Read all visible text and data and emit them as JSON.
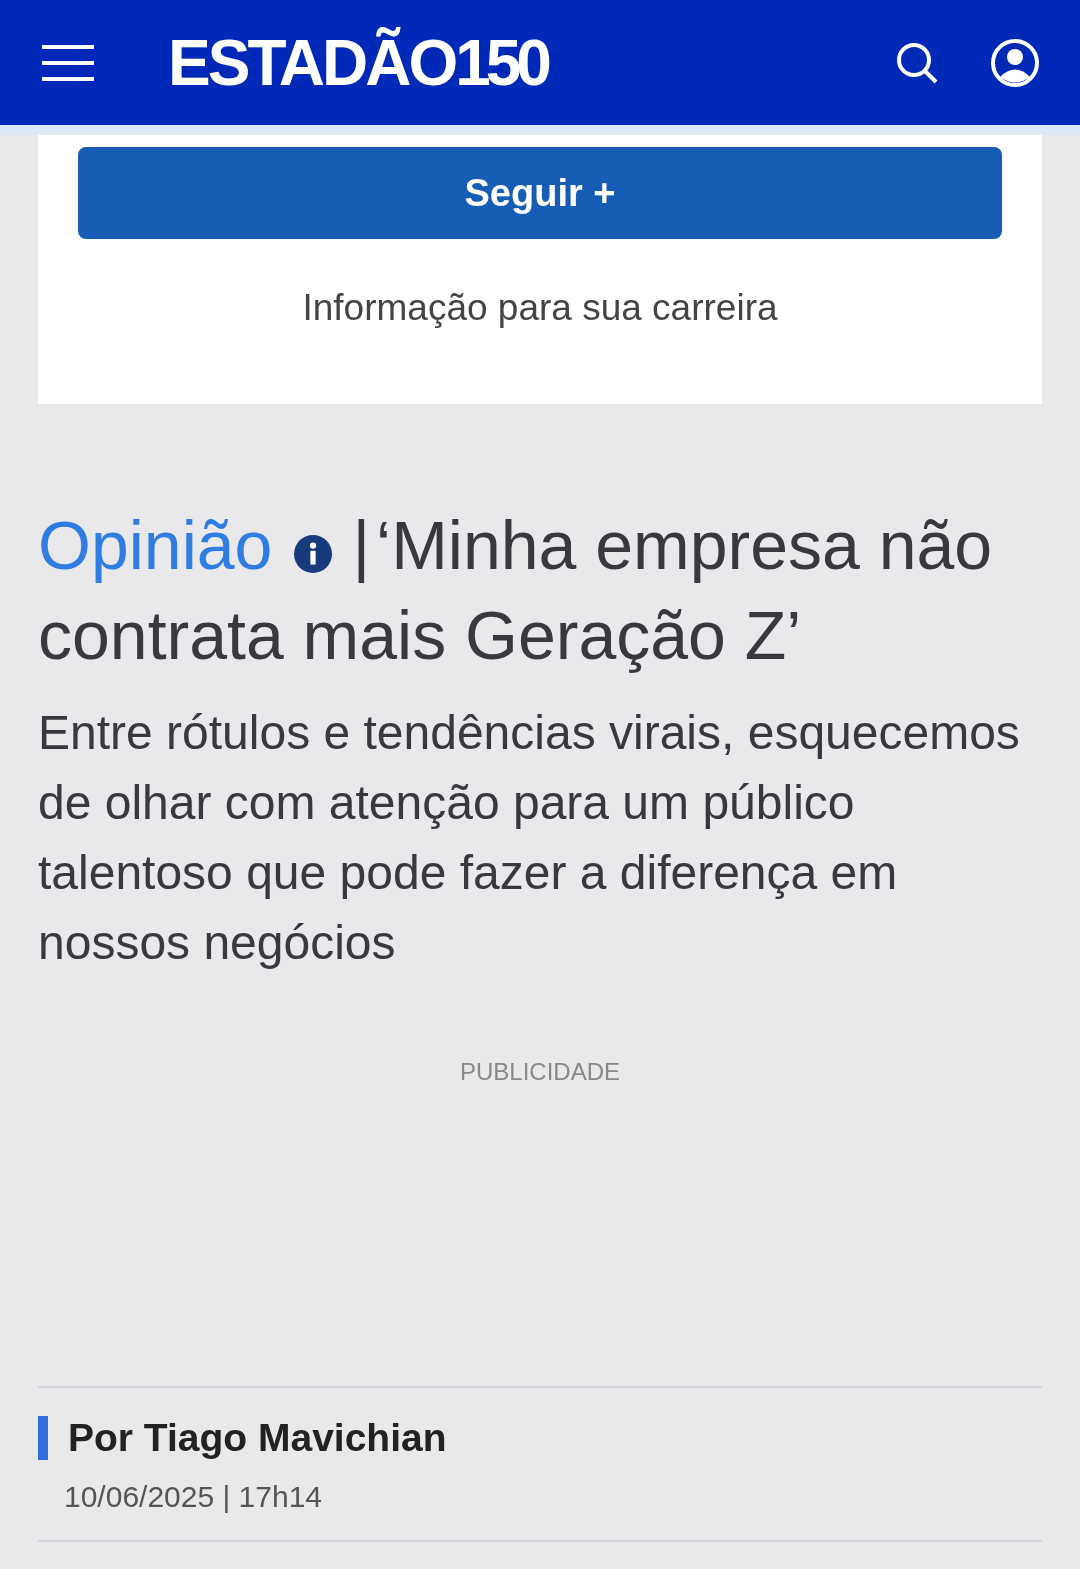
{
  "header": {
    "logo_name": "ESTADÃO",
    "logo_number": "150"
  },
  "follow_card": {
    "button": "Seguir +",
    "tagline": "Informação para sua carreira"
  },
  "article": {
    "section": "Opinião",
    "separator": "|",
    "title": "‘Minha empresa não contrata mais Geração Z’",
    "subtitle": "Entre rótulos e tendências virais, esquecemos de olhar com atenção para um público talentoso que pode fazer a diferença em nossos negócios",
    "ad_label": "PUBLICIDADE",
    "author": "Por Tiago Mavichian",
    "date": "10/06/2025 | 17h14"
  }
}
